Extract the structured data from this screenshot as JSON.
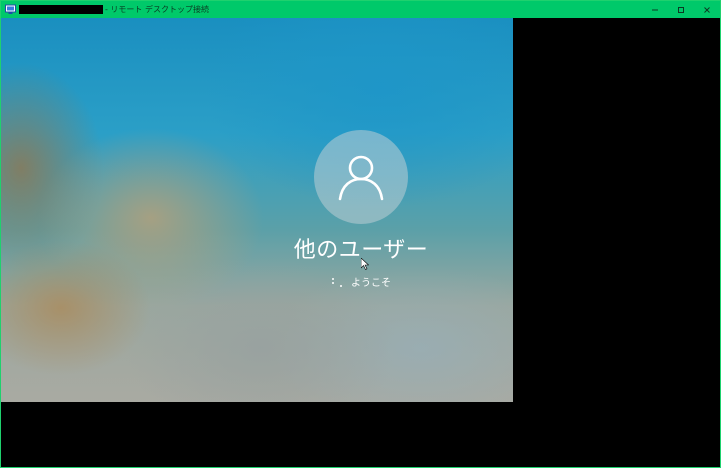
{
  "window": {
    "title": "- リモート デスクトップ接続",
    "controls": {
      "minimize": "–",
      "maximize": "□",
      "close": "✕"
    },
    "colors": {
      "titlebar": "#00c96a",
      "border": "#1fd16e"
    }
  },
  "lockscreen": {
    "avatar_icon": "user-icon",
    "username": "他のユーザー",
    "welcome_text": "ようこそ"
  }
}
